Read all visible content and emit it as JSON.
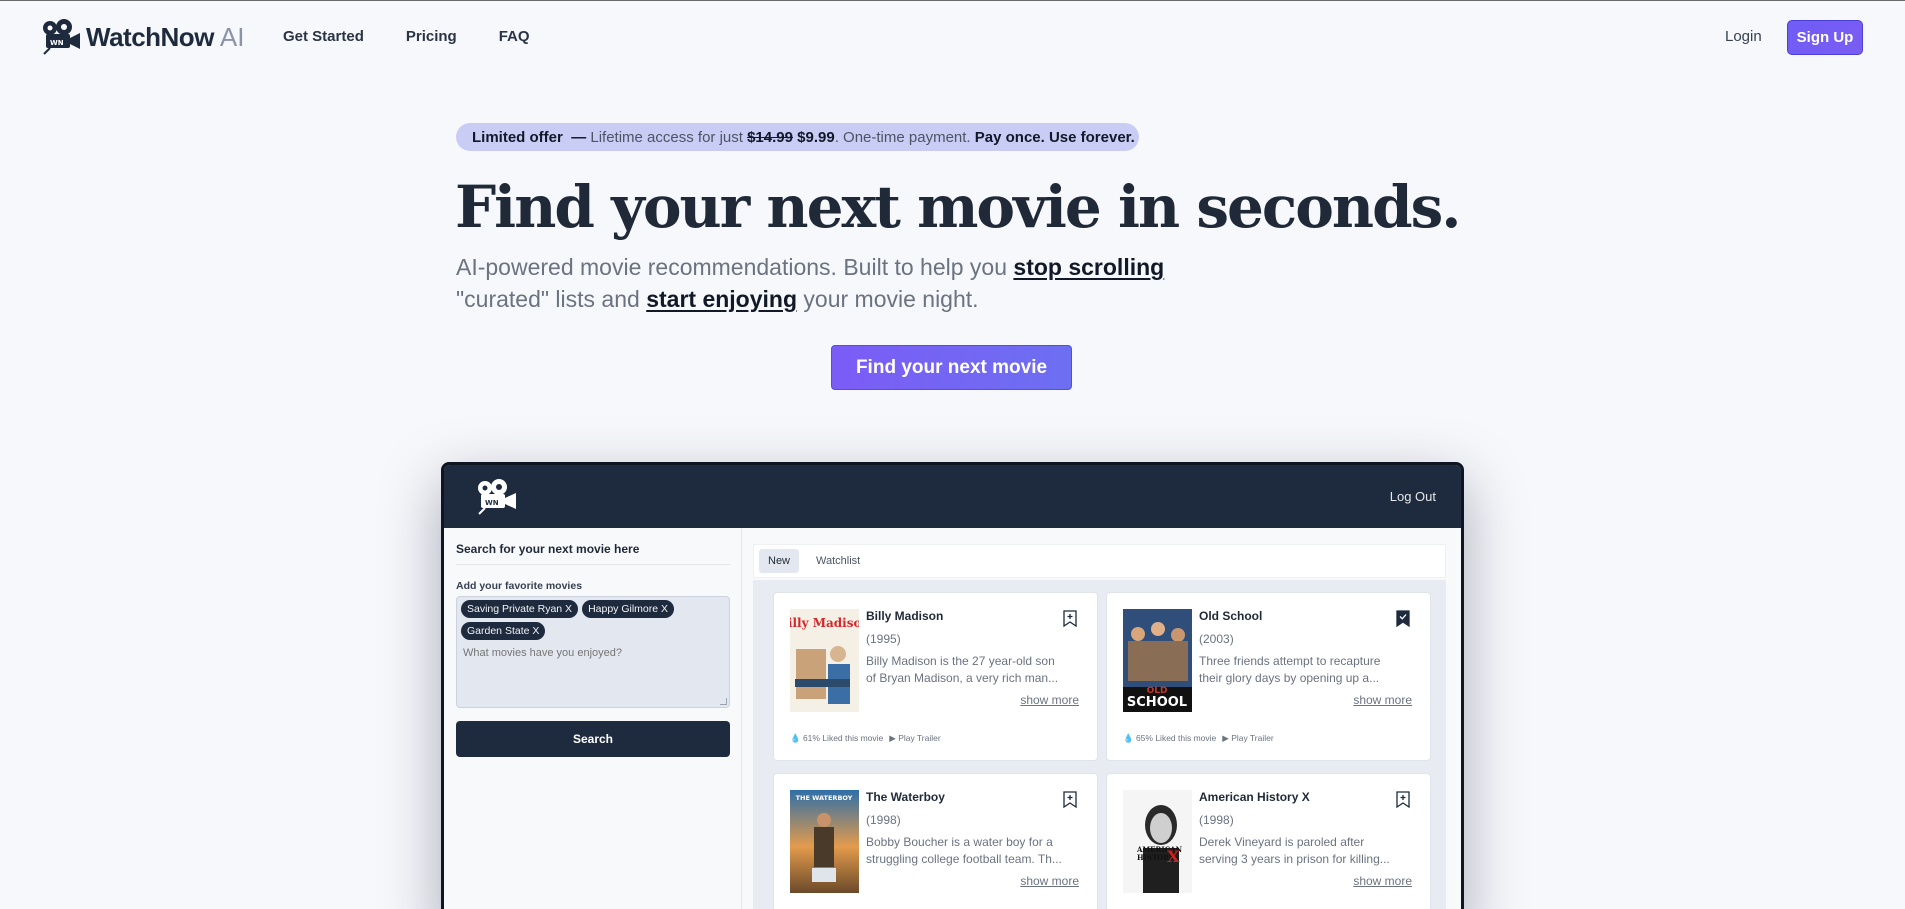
{
  "brand": {
    "name": "WatchNow",
    "suffix": "AI"
  },
  "nav": {
    "links": [
      "Get Started",
      "Pricing",
      "FAQ"
    ],
    "login": "Login",
    "signup": "Sign Up"
  },
  "offer": {
    "lead": "Limited offer",
    "dash": "—",
    "text1": "Lifetime access for just",
    "old_price": "$14.99",
    "new_price": "$9.99",
    "text2": ". One-time payment.",
    "tail": "Pay once. Use forever."
  },
  "hero": {
    "headline": "Find your next movie in seconds.",
    "sub_1": "AI-powered movie recommendations. Built to help you",
    "sub_em1": "stop scrolling",
    "sub_2": "\"curated\" lists and",
    "sub_em2": "start enjoying",
    "sub_3": "your movie night.",
    "cta": "Find your next movie"
  },
  "app": {
    "logout": "Log Out",
    "sidebar": {
      "title": "Search for your next movie here",
      "label": "Add your favorite movies",
      "chips": [
        "Saving Private Ryan X",
        "Happy Gilmore X",
        "Garden State X"
      ],
      "placeholder": "What movies have you enjoyed?",
      "search": "Search"
    },
    "tabs": [
      "New",
      "Watchlist"
    ],
    "movies": [
      {
        "title": "Billy Madison",
        "year": "(1995)",
        "desc1": "Billy Madison is the 27 year-old son",
        "desc2": "of Bryan Madison, a very rich man...",
        "more": "show more",
        "liked": "61% Liked this movie",
        "trailer": "Play Trailer",
        "poster_text": "Billy Madison"
      },
      {
        "title": "Old School",
        "year": "(2003)",
        "desc1": "Three friends attempt to recapture",
        "desc2": "their glory days by opening up a...",
        "more": "show more",
        "liked": "65% Liked this movie",
        "trailer": "Play Trailer",
        "poster_text": "OLD SCHOOL"
      },
      {
        "title": "The Waterboy",
        "year": "(1998)",
        "desc1": "Bobby Boucher is a water boy for a",
        "desc2": "struggling college football team. Th...",
        "more": "show more",
        "liked": "",
        "trailer": "",
        "poster_text": "THE WATERBOY"
      },
      {
        "title": "American History X",
        "year": "(1998)",
        "desc1": "Derek Vineyard is paroled after",
        "desc2": "serving 3 years in prison for killing...",
        "more": "show more",
        "liked": "",
        "trailer": "",
        "poster_text": "AMERICAN HISTORY X"
      }
    ]
  },
  "colors": {
    "accent": "#6f5cf6",
    "navy": "#1e2a3d",
    "offer_bg": "#c9cdf6"
  }
}
